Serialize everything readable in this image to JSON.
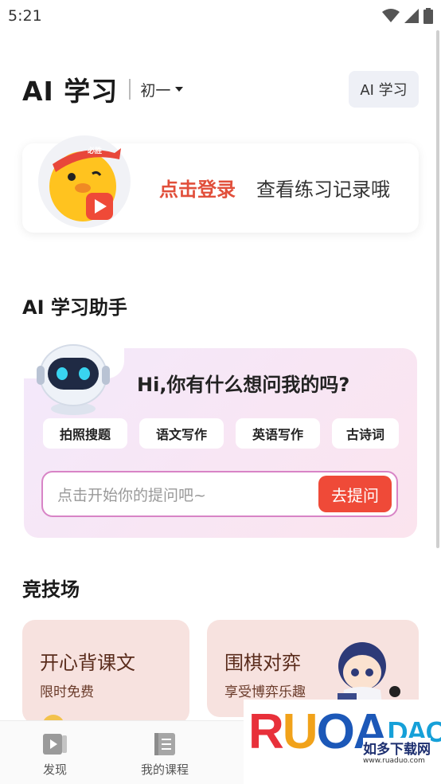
{
  "status_bar": {
    "time": "5:21"
  },
  "header": {
    "title": "AI 学习",
    "grade": "初一",
    "chip_label": "AI 学习"
  },
  "login_card": {
    "link_text": "点击登录",
    "desc": "查看练习记录哦",
    "mascot_badge": "必胜"
  },
  "assistant": {
    "section_title": "AI 学习助手",
    "greeting": "Hi,你有什么想问我的吗?",
    "tags": [
      "拍照搜题",
      "语文写作",
      "英语写作",
      "古诗词"
    ],
    "input_placeholder": "点击开始你的提问吧~",
    "ask_button": "去提问"
  },
  "arena": {
    "section_title": "竞技场",
    "cards": [
      {
        "title": "开心背课文",
        "subtitle": "限时免费"
      },
      {
        "title": "围棋对弈",
        "subtitle": "享受博弈乐趣"
      }
    ]
  },
  "bottom_nav": {
    "items": [
      {
        "label": "发现",
        "icon": "play-book-icon"
      },
      {
        "label": "我的课程",
        "icon": "notebook-icon"
      }
    ]
  },
  "watermark": {
    "brand_r": "R",
    "brand_u": "U",
    "brand_a": "A",
    "brand_o": "O",
    "brand_rest": "DAO",
    "cn": "如多下载网",
    "url": "www.ruaduo.com"
  },
  "colors": {
    "accent_red": "#e14f3b",
    "ask_button": "#ef4a38",
    "card_bg": "#f7e2df"
  }
}
